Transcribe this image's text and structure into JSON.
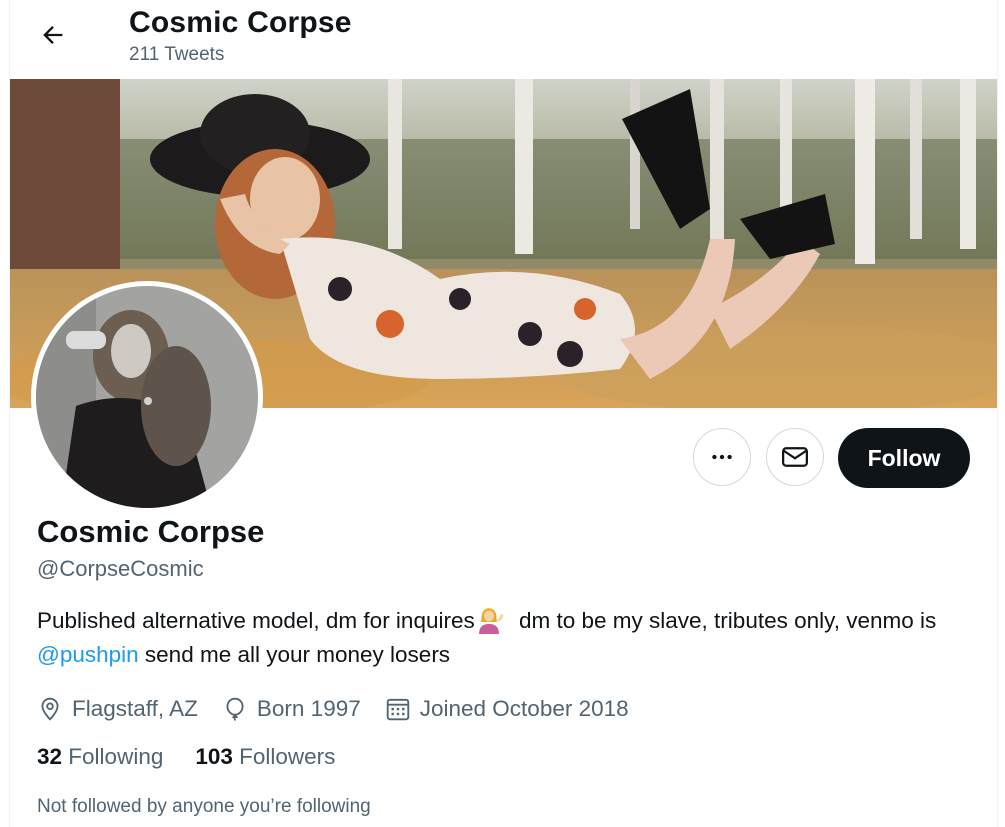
{
  "header": {
    "title": "Cosmic Corpse",
    "tweet_count": "211 Tweets",
    "back_icon": "arrow-left-icon"
  },
  "profile": {
    "display_name": "Cosmic Corpse",
    "handle": "@CorpseCosmic",
    "bio": {
      "part1": "Published alternative model, dm for inquires",
      "emoji": "woman-tipping-hand-emoji",
      "part2": " dm to be my slave, tributes only, venmo is ",
      "mention": "@pushpin",
      "part3": " send me all your money losers"
    },
    "location": "Flagstaff, AZ",
    "birth": "Born 1997",
    "joined": "Joined October 2018",
    "following_count": "32",
    "following_label": "Following",
    "followers_count": "103",
    "followers_label": "Followers",
    "not_followed_note": "Not followed by anyone you’re following"
  },
  "actions": {
    "more_icon": "more-dots-icon",
    "message_icon": "envelope-icon",
    "follow_label": "Follow"
  },
  "colors": {
    "accent": "#1d9bf0",
    "follow_button_bg": "#0f1419",
    "secondary_text": "#536471"
  }
}
